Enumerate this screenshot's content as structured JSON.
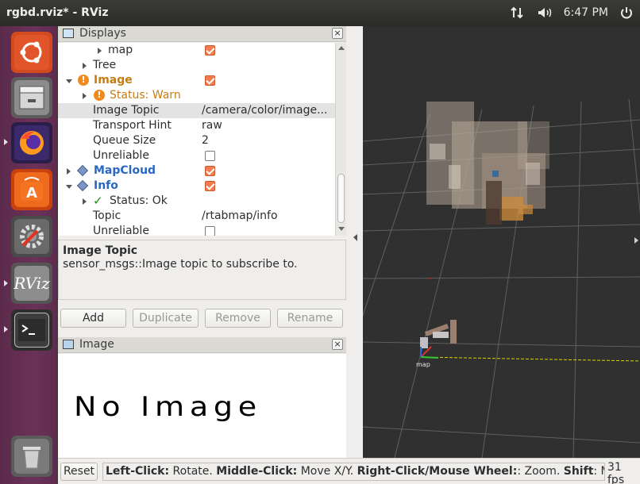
{
  "window": {
    "title": "rgbd.rviz* - RViz"
  },
  "tray": {
    "clock": "6:47 PM",
    "network_icon": "network-arrows-icon",
    "volume_icon": "volume-icon",
    "power_icon": "power-icon"
  },
  "launcher": {
    "items": [
      {
        "name": "ubuntu-icon"
      },
      {
        "name": "files-icon"
      },
      {
        "name": "firefox-icon"
      },
      {
        "name": "software-center-icon"
      },
      {
        "name": "settings-icon"
      },
      {
        "name": "rviz-icon",
        "label": "RViz"
      },
      {
        "name": "terminal-icon"
      },
      {
        "name": "trash-icon"
      }
    ]
  },
  "displays": {
    "title": "Displays",
    "rows": [
      {
        "label": "map"
      },
      {
        "label": "Tree"
      },
      {
        "label": "Image"
      },
      {
        "label": "Status: Warn"
      },
      {
        "label": "Image Topic",
        "value": "/camera/color/image..."
      },
      {
        "label": "Transport Hint",
        "value": "raw"
      },
      {
        "label": "Queue Size",
        "value": "2"
      },
      {
        "label": "Unreliable"
      },
      {
        "label": "MapCloud"
      },
      {
        "label": "Info"
      },
      {
        "label": "Status: Ok"
      },
      {
        "label": "Topic",
        "value": "/rtabmap/info"
      },
      {
        "label": "Unreliable"
      }
    ]
  },
  "description": {
    "title": "Image Topic",
    "text": "sensor_msgs::Image topic to subscribe to."
  },
  "buttons": {
    "add": "Add",
    "duplicate": "Duplicate",
    "remove": "Remove",
    "rename": "Rename"
  },
  "image_panel": {
    "title": "Image",
    "message": "No Image"
  },
  "viewport": {
    "frame_label": "map"
  },
  "bottom": {
    "reset": "Reset",
    "help_bold_1": "Left-Click:",
    "help_1": " Rotate. ",
    "help_bold_2": "Middle-Click:",
    "help_2": " Move X/Y. ",
    "help_bold_3": "Right-Click/Mouse Wheel:",
    "help_3": ": Zoom. ",
    "help_bold_4": "Shift",
    "help_4": ": More o",
    "fps": "31 fps"
  },
  "colors": {
    "launcher": "#6b3258",
    "accent": "#f57c4e",
    "warn": "#c77c11",
    "display_link": "#2a67c5",
    "viewport_bg": "#303030"
  }
}
